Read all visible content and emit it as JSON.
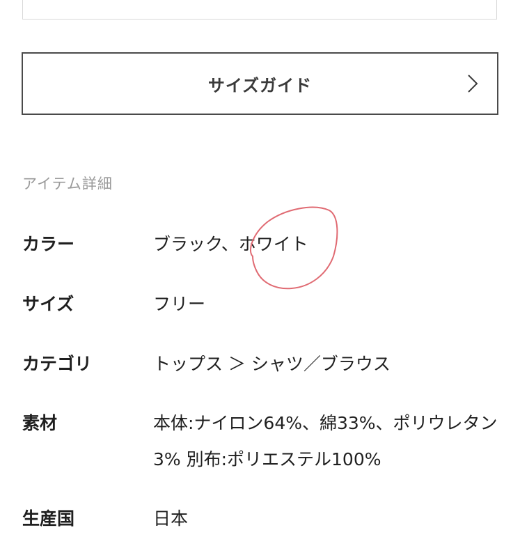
{
  "size_guide": {
    "label": "サイズガイド",
    "icon": "chevron-right-icon"
  },
  "item_details": {
    "title": "アイテム詳細",
    "rows": [
      {
        "label": "カラー",
        "value": "ブラック、ホワイト"
      },
      {
        "label": "サイズ",
        "value": "フリー"
      },
      {
        "label": "カテゴリ",
        "value": "トップス ＞ シャツ／ブラウス"
      },
      {
        "label": "素材",
        "value": "本体:ナイロン64%、綿33%、ポリウレタン3% 別布:ポリエステル100%"
      },
      {
        "label": "生産国",
        "value": "日本"
      }
    ]
  },
  "annotation": {
    "color": "#e06a72",
    "icon": "hand-drawn-circle"
  }
}
